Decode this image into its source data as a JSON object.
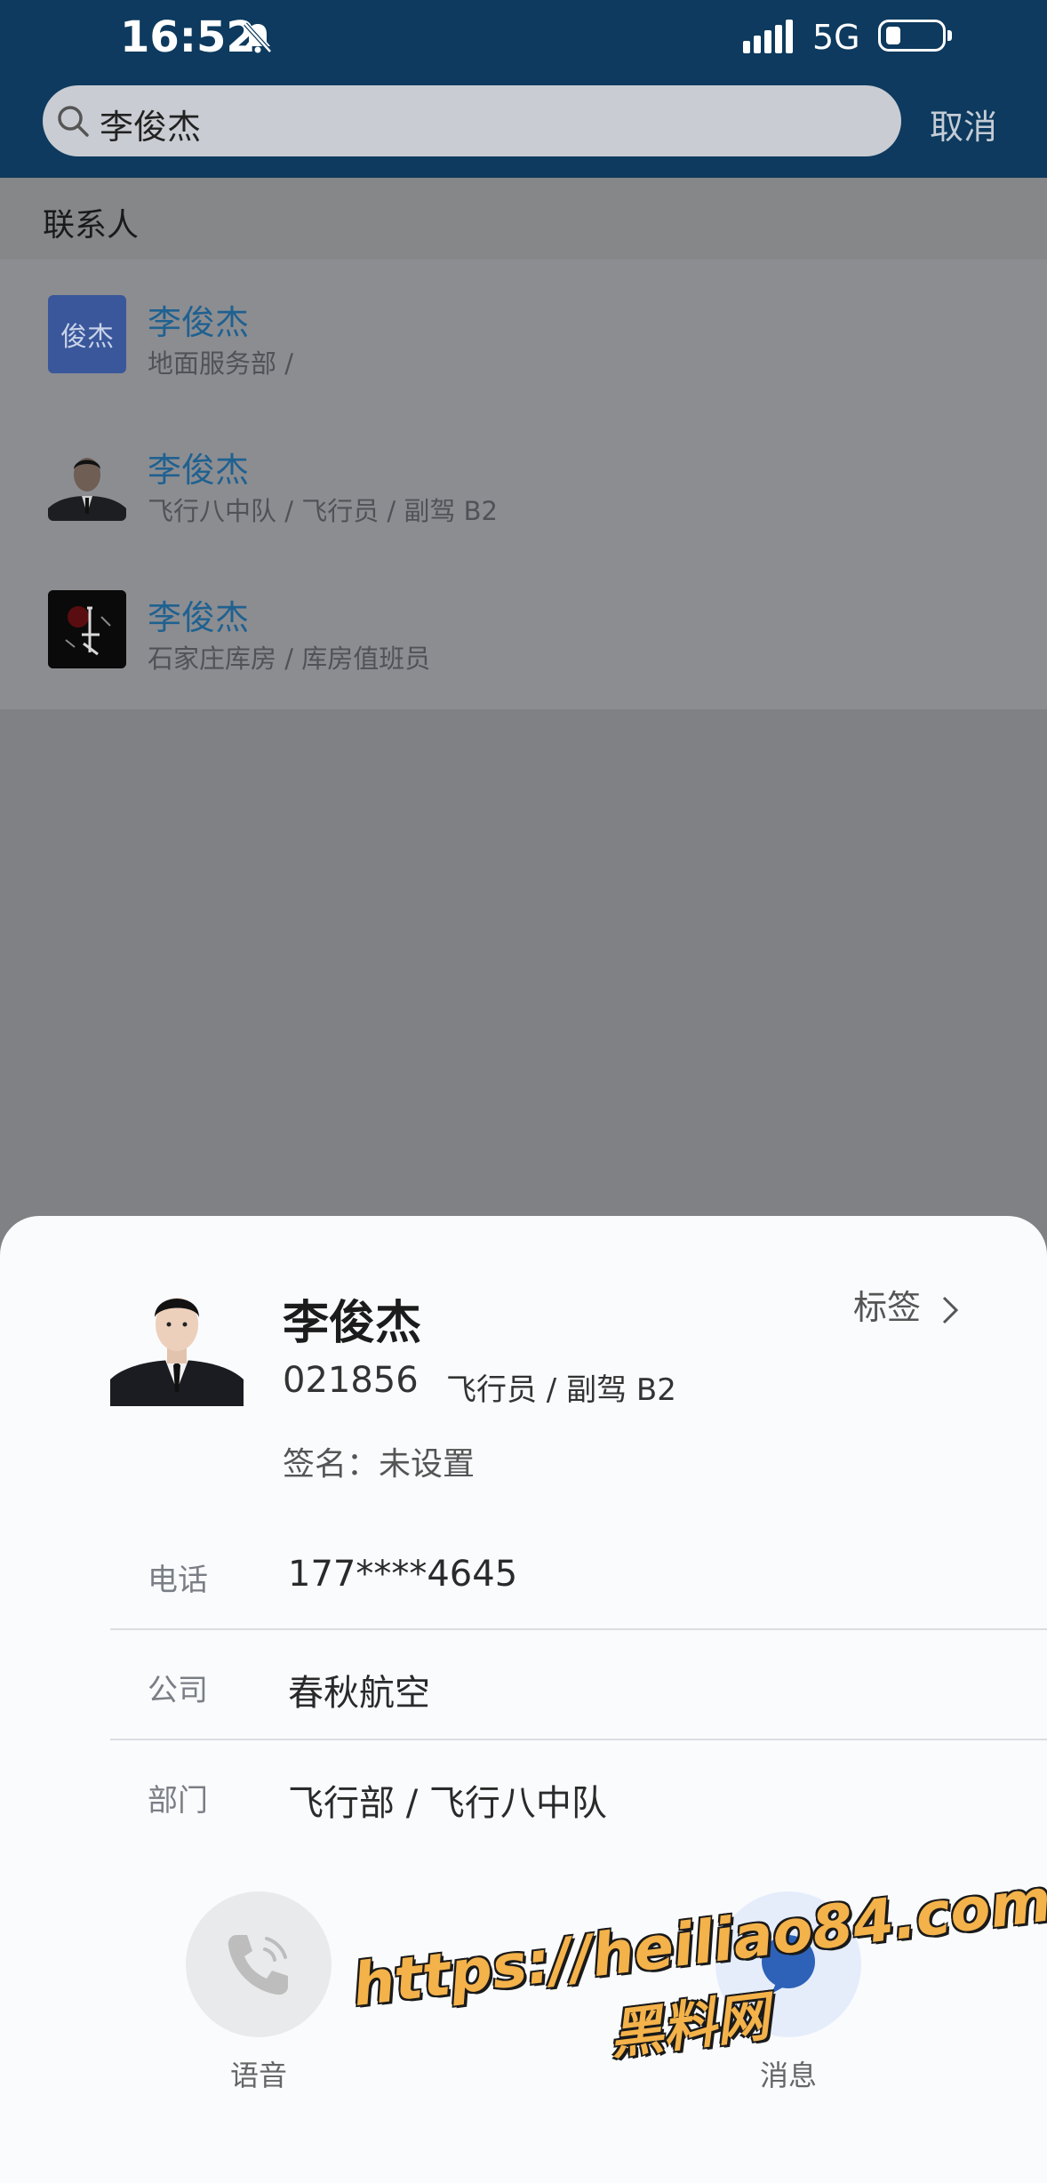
{
  "status_bar": {
    "time": "16:52",
    "network": "5G",
    "icons": [
      "bell-muted-icon",
      "signal-icon",
      "battery-icon"
    ]
  },
  "search": {
    "query": "李俊杰",
    "cancel_label": "取消"
  },
  "contacts_section": {
    "title": "联系人",
    "items": [
      {
        "name": "李俊杰",
        "dept": "地面服务部 /",
        "avatar_text": "俊杰"
      },
      {
        "name": "李俊杰",
        "dept": "飞行八中队 / 飞行员 / 副驾 B2",
        "avatar_text": ""
      },
      {
        "name": "李俊杰",
        "dept": "石家庄库房 / 库房值班员",
        "avatar_text": ""
      }
    ]
  },
  "card": {
    "name": "李俊杰",
    "tag_label": "标签",
    "employee_id": "021856",
    "role": "飞行员 / 副驾 B2",
    "signature": "签名：未设置",
    "fields": [
      {
        "label": "电话",
        "value": "177****4645"
      },
      {
        "label": "公司",
        "value": "春秋航空"
      },
      {
        "label": "部门",
        "value": "飞行部 / 飞行八中队"
      }
    ],
    "actions": [
      {
        "label": "语音",
        "icon": "phone-icon"
      },
      {
        "label": "消息",
        "icon": "message-icon"
      }
    ]
  },
  "watermark": {
    "url": "https://heiliao84.com",
    "name": "黑料网"
  },
  "colors": {
    "topbar": "#0d3a5e",
    "contact_name": "#1f6190",
    "watermark": "#f4b24a"
  }
}
